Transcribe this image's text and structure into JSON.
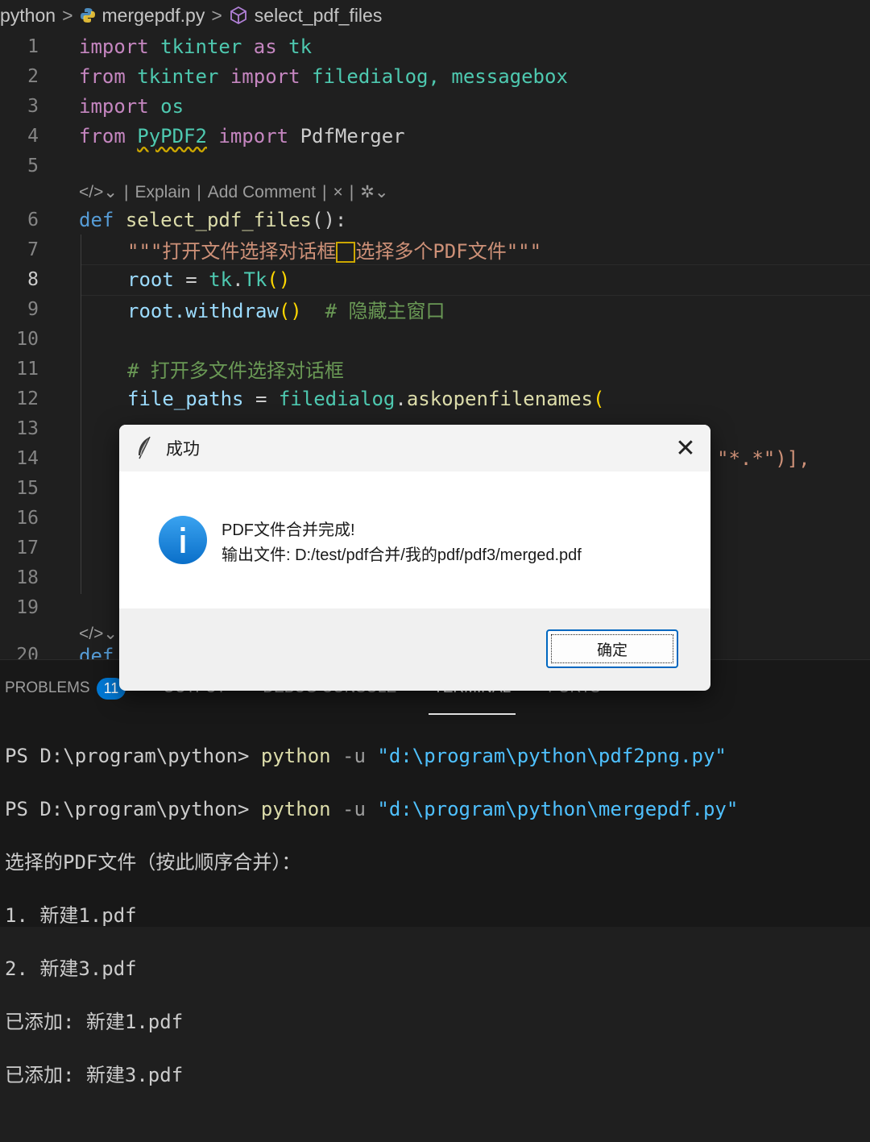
{
  "breadcrumb": {
    "folder": "python",
    "file": "mergepdf.py",
    "symbol": "select_pdf_files"
  },
  "editor": {
    "codelens_1": {
      "explain": "Explain",
      "add_comment": "Add Comment",
      "close": "×"
    },
    "lines": {
      "n1": "1",
      "n2": "2",
      "n3": "3",
      "n4": "4",
      "n5": "5",
      "n6": "6",
      "n7": "7",
      "n8": "8",
      "n9": "9",
      "n10": "10",
      "n11": "11",
      "n12": "12",
      "n13": "13",
      "n14": "14",
      "n15": "15",
      "n16": "16",
      "n17": "17",
      "n18": "18",
      "n19": "19",
      "n20": "20"
    },
    "code": {
      "l1_import": "import",
      "l1_mod": "tkinter",
      "l1_as": "as",
      "l1_alias": "tk",
      "l2_from": "from",
      "l2_mod": "tkinter",
      "l2_import": "import",
      "l2_names": "filedialog, messagebox",
      "l3_import": "import",
      "l3_mod": "os",
      "l4_from": "from",
      "l4_mod": "PyPDF2",
      "l4_import": "import",
      "l4_name": "PdfMerger",
      "l6_def": "def",
      "l6_fn": "select_pdf_files",
      "l6_rest": "():",
      "l7_doc_a": "\"\"\"打开文件选择对话框",
      "l7_doc_b": "选择多个PDF文件\"\"\"",
      "l8_var": "root",
      "l8_eq": " = ",
      "l8_mod": "tk",
      "l8_cls": "Tk",
      "l9_call": "root.withdraw",
      "l9_comment": "# 隐藏主窗口",
      "l11_comment": "# 打开多文件选择对话框",
      "l12_var": "file_paths",
      "l12_eq": " = ",
      "l12_mod": "filedialog",
      "l12_fn": "askopenfilenames",
      "l14_tail": "\"*.*\")],",
      "l20_def": "def"
    }
  },
  "panel": {
    "tabs": [
      "PROBLEMS",
      "OUTPUT",
      "DEBUG CONSOLE",
      "TERMINAL",
      "PORTS"
    ],
    "problems_count": "11",
    "terminal": {
      "prompt1": "PS D:\\program\\python> ",
      "cmd1": "python",
      "flag1": " -u ",
      "arg1": "\"d:\\program\\python\\pdf2png.py\"",
      "prompt2": "PS D:\\program\\python> ",
      "cmd2": "python",
      "flag2": " -u ",
      "arg2": "\"d:\\program\\python\\mergepdf.py\"",
      "out1": "选择的PDF文件（按此顺序合并）：",
      "out2": "1. 新建1.pdf",
      "out3": "2. 新建3.pdf",
      "out4": "已添加: 新建1.pdf",
      "out5": "已添加: 新建3.pdf"
    }
  },
  "dialog": {
    "title": "成功",
    "message_line1": "PDF文件合并完成!",
    "message_line2": "输出文件: D:/test/pdf合并/我的pdf/pdf3/merged.pdf",
    "ok_label": "确定",
    "info_icon": "i"
  },
  "colors": {
    "editor_bg": "#1f1f1f",
    "accent": "#0078d4",
    "dialog_bg": "#f0f0f0"
  }
}
